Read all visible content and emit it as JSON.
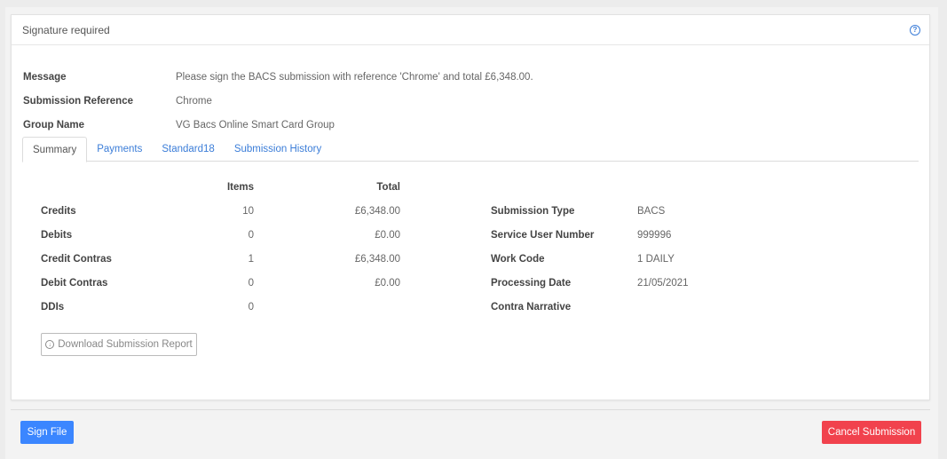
{
  "card": {
    "title": "Signature required",
    "help_icon": "question-circle-icon"
  },
  "meta": [
    {
      "label": "Message",
      "value": "Please sign the BACS submission with reference 'Chrome' and total £6,348.00."
    },
    {
      "label": "Submission Reference",
      "value": "Chrome"
    },
    {
      "label": "Group Name",
      "value": "VG Bacs Online Smart Card Group"
    }
  ],
  "tabs": [
    {
      "label": "Summary",
      "active": true
    },
    {
      "label": "Payments",
      "active": false
    },
    {
      "label": "Standard18",
      "active": false
    },
    {
      "label": "Submission History",
      "active": false
    }
  ],
  "summary": {
    "headers": {
      "items": "Items",
      "total": "Total"
    },
    "rows": [
      {
        "label": "Credits",
        "items": "10",
        "total": "£6,348.00"
      },
      {
        "label": "Debits",
        "items": "0",
        "total": "£0.00"
      },
      {
        "label": "Credit Contras",
        "items": "1",
        "total": "£6,348.00"
      },
      {
        "label": "Debit Contras",
        "items": "0",
        "total": "£0.00"
      },
      {
        "label": "DDIs",
        "items": "0",
        "total": ""
      }
    ],
    "details": [
      {
        "label": "Submission Type",
        "value": "BACS"
      },
      {
        "label": "Service User Number",
        "value": "999996"
      },
      {
        "label": "Work Code",
        "value": "1 DAILY"
      },
      {
        "label": "Processing Date",
        "value": "21/05/2021"
      },
      {
        "label": "Contra Narrative",
        "value": ""
      }
    ]
  },
  "download_button": {
    "label": "Download Submission Report",
    "icon": "download-circle-icon"
  },
  "footer": {
    "sign_label": "Sign File",
    "cancel_label": "Cancel Submission"
  },
  "colors": {
    "link": "#3b7dd8",
    "primary": "#3b86ff",
    "danger": "#f1424d"
  }
}
